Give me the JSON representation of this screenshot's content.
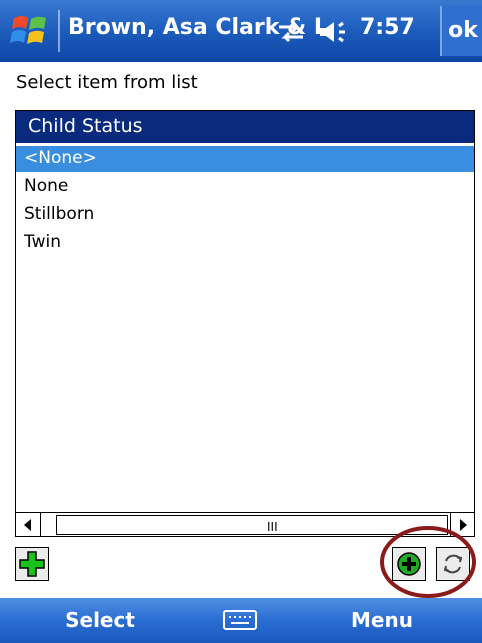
{
  "title_bar": {
    "title": "Brown, Asa Clark & I",
    "time": "7:57",
    "ok_label": "ok",
    "icons": [
      "windows-start-icon",
      "connectivity-icon",
      "volume-icon"
    ]
  },
  "prompt": "Select item from list",
  "list": {
    "header": "Child Status",
    "items": [
      "<None>",
      "None",
      "Stillborn",
      "Twin"
    ],
    "selected_index": 0
  },
  "scrollbar": {
    "grip": "III"
  },
  "buttons": {
    "add": "plus-icon",
    "add_green": "add-circle-icon",
    "refresh": "refresh-icon"
  },
  "soft_keys": {
    "left": "Select",
    "right": "Menu"
  },
  "colors": {
    "title_bar": "#1f5fbf",
    "list_header": "#0a2a7d",
    "selection": "#3a8ee0",
    "annotation_circle": "#8b1a1a"
  }
}
